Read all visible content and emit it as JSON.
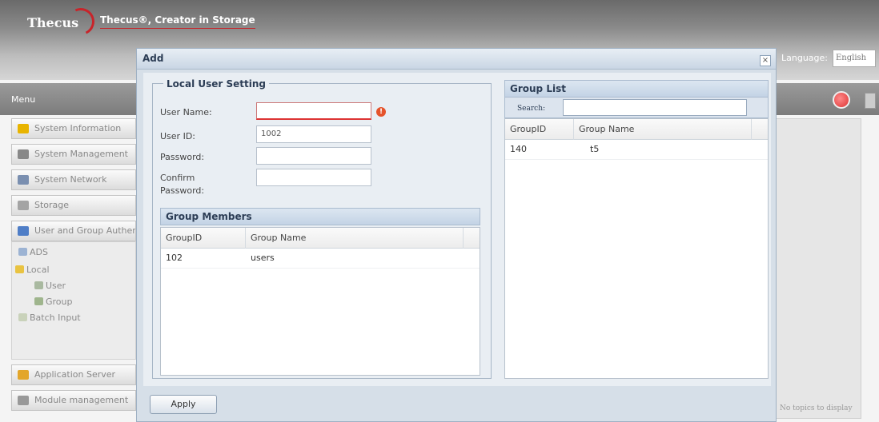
{
  "app": {
    "logo_text": "Thecus",
    "tagline": "Thecus®, Creator in Storage",
    "language_label": "Language:",
    "language_value": "English",
    "menu_label": "Menu",
    "no_topics_text": "No topics to display"
  },
  "sidebar": {
    "items": [
      {
        "label": "System Information",
        "icon": "info-icon"
      },
      {
        "label": "System Management",
        "icon": "tools-icon"
      },
      {
        "label": "System Network",
        "icon": "network-icon"
      },
      {
        "label": "Storage",
        "icon": "storage-icon"
      },
      {
        "label": "User and Group Authentication",
        "icon": "users-icon"
      },
      {
        "label": "Application Server",
        "icon": "app-server-icon"
      },
      {
        "label": "Module management",
        "icon": "module-icon"
      }
    ],
    "tree": [
      {
        "label": "ADS"
      },
      {
        "label": "Local"
      },
      {
        "label": "User"
      },
      {
        "label": "Group"
      },
      {
        "label": "Batch Input"
      }
    ]
  },
  "modal": {
    "title": "Add",
    "close_symbol": "×",
    "local_user": {
      "legend": "Local User Setting",
      "username_label": "User Name:",
      "username_value": "",
      "userid_label": "User ID:",
      "userid_value": "1002",
      "password_label": "Password:",
      "password_value": "",
      "confirm_label_1": "Confirm",
      "confirm_label_2": "Password:",
      "confirm_value": ""
    },
    "group_members": {
      "title": "Group Members",
      "columns": [
        "GroupID",
        "Group Name"
      ],
      "rows": [
        {
          "id": "102",
          "name": "users"
        }
      ]
    },
    "group_list": {
      "title": "Group List",
      "search_label": "Search:",
      "search_value": "",
      "columns": [
        "GroupID",
        "Group Name"
      ],
      "rows": [
        {
          "id": "140",
          "name": "t5"
        }
      ]
    },
    "apply_label": "Apply"
  },
  "colors": {
    "accent": "#2c3d55",
    "error": "#e5532b",
    "logo_swoosh": "#c8242a"
  }
}
